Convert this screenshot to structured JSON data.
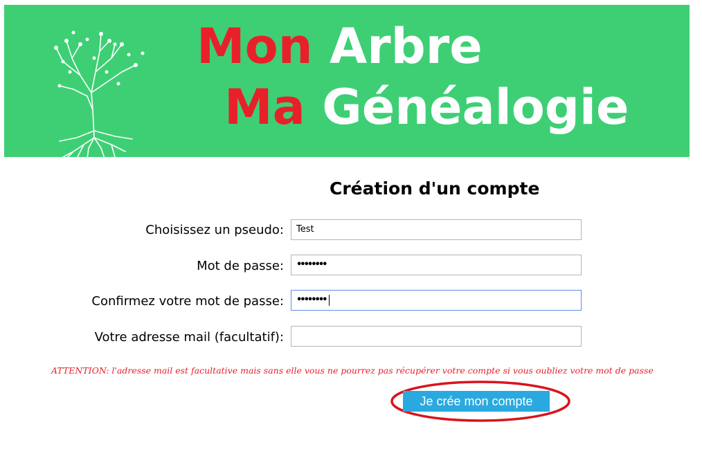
{
  "header": {
    "title_line1_red": "Mon",
    "title_line1_white": "Arbre",
    "title_line2_red": "Ma",
    "title_line2_white": "Généalogie",
    "logo_icon": "tree-roots-icon",
    "background_color": "#3ecf75",
    "red_color": "#e8202a"
  },
  "form": {
    "title": "Création d'un compte",
    "fields": [
      {
        "label": "Choisissez un pseudo:",
        "value": "Test",
        "type": "text"
      },
      {
        "label": "Mot de passe:",
        "value": "••••••••",
        "type": "password"
      },
      {
        "label": "Confirmez votre mot de passe:",
        "value": "••••••••",
        "type": "password",
        "focused": true
      },
      {
        "label": "Votre adresse mail (facultatif):",
        "value": "",
        "type": "email"
      }
    ],
    "warning": "ATTENTION: l'adresse mail est facultative mais sans elle vous ne pourrez pas récupérer votre compte si vous oubliez votre mot de passe",
    "submit_label": "Je crée mon compte",
    "submit_color": "#2aa9e0",
    "highlight_color": "#d8141c"
  }
}
